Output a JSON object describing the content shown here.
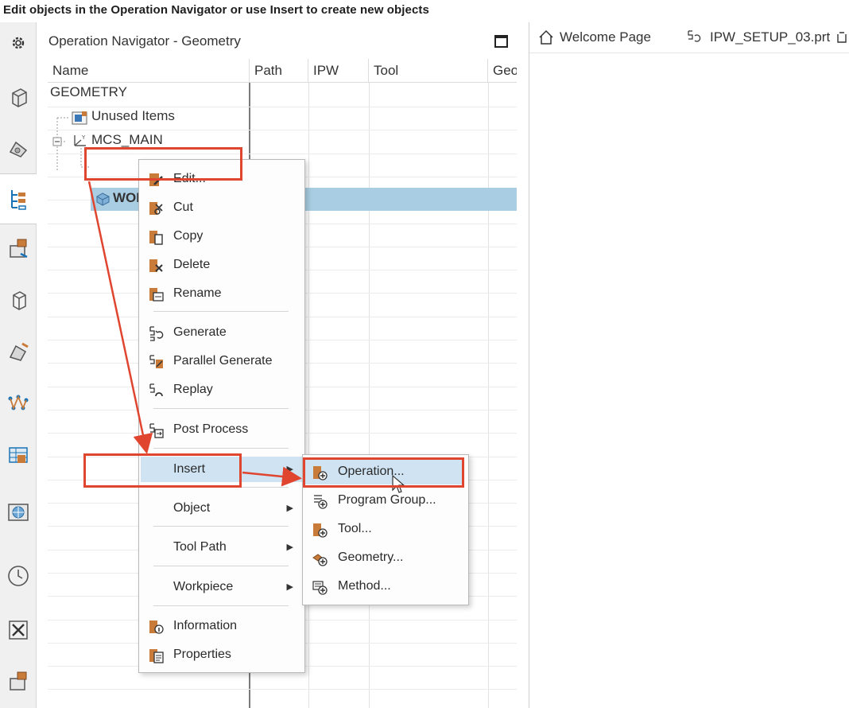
{
  "status_hint": "Edit objects in the Operation Navigator or use Insert to create new objects",
  "navigator": {
    "title": "Operation Navigator - Geometry",
    "columns": [
      "Name",
      "Path",
      "IPW",
      "Tool",
      "Geo"
    ]
  },
  "tree": {
    "root": "GEOMETRY",
    "unused": "Unused Items",
    "mcs": "MCS_MAIN",
    "selected": "WORKPIECE"
  },
  "context_menu": {
    "items": [
      {
        "label": "Edit...",
        "icon": "edit-icon"
      },
      {
        "label": "Cut",
        "icon": "cut-icon"
      },
      {
        "label": "Copy",
        "icon": "copy-icon"
      },
      {
        "label": "Delete",
        "icon": "delete-icon"
      },
      {
        "label": "Rename",
        "icon": "rename-icon"
      },
      {
        "label": "Generate",
        "icon": "generate-icon"
      },
      {
        "label": "Parallel Generate",
        "icon": "parallel-generate-icon"
      },
      {
        "label": "Replay",
        "icon": "replay-icon"
      },
      {
        "label": "Post Process",
        "icon": "post-process-icon"
      },
      {
        "label": "Insert",
        "submenu": true
      },
      {
        "label": "Object",
        "submenu": true
      },
      {
        "label": "Tool Path",
        "submenu": true
      },
      {
        "label": "Workpiece",
        "submenu": true
      },
      {
        "label": "Information",
        "icon": "information-icon"
      },
      {
        "label": "Properties",
        "icon": "properties-icon"
      }
    ]
  },
  "insert_submenu": {
    "items": [
      {
        "label": "Operation...",
        "icon": "create-operation-icon"
      },
      {
        "label": "Program Group...",
        "icon": "create-program-group-icon"
      },
      {
        "label": "Tool...",
        "icon": "create-tool-icon"
      },
      {
        "label": "Geometry...",
        "icon": "create-geometry-icon"
      },
      {
        "label": "Method...",
        "icon": "create-method-icon"
      }
    ]
  },
  "tabs": {
    "welcome": "Welcome Page",
    "part": "IPW_SETUP_03.prt"
  },
  "colors": {
    "selection": "#a9cde2",
    "highlight": "#cfe3f2",
    "annotation": "#e0452f",
    "icon_orange": "#c97b3a"
  }
}
